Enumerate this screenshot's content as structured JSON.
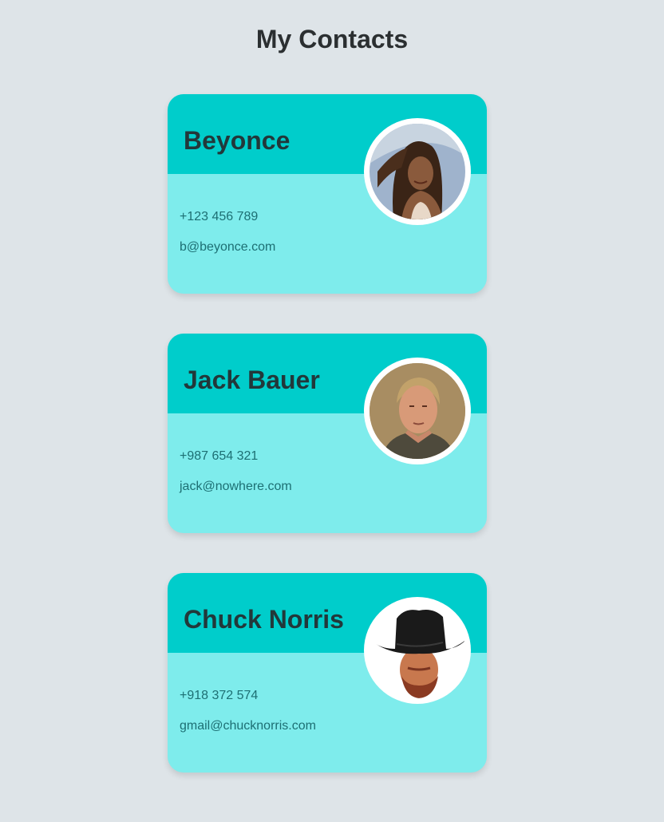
{
  "page": {
    "title": "My Contacts"
  },
  "contacts": [
    {
      "name": "Beyonce",
      "phone": "+123 456 789",
      "email": "b@beyonce.com",
      "photo": "portrait-photo"
    },
    {
      "name": "Jack Bauer",
      "phone": "+987 654 321",
      "email": "jack@nowhere.com",
      "photo": "portrait-photo"
    },
    {
      "name": "Chuck Norris",
      "phone": "+918 372 574",
      "email": "gmail@chucknorris.com",
      "photo": "portrait-photo"
    }
  ],
  "colors": {
    "background": "#dee4e8",
    "card_header": "#00cdcb",
    "card_body": "#7eecec",
    "name_text": "#22383a",
    "detail_text": "#1d6f73"
  }
}
